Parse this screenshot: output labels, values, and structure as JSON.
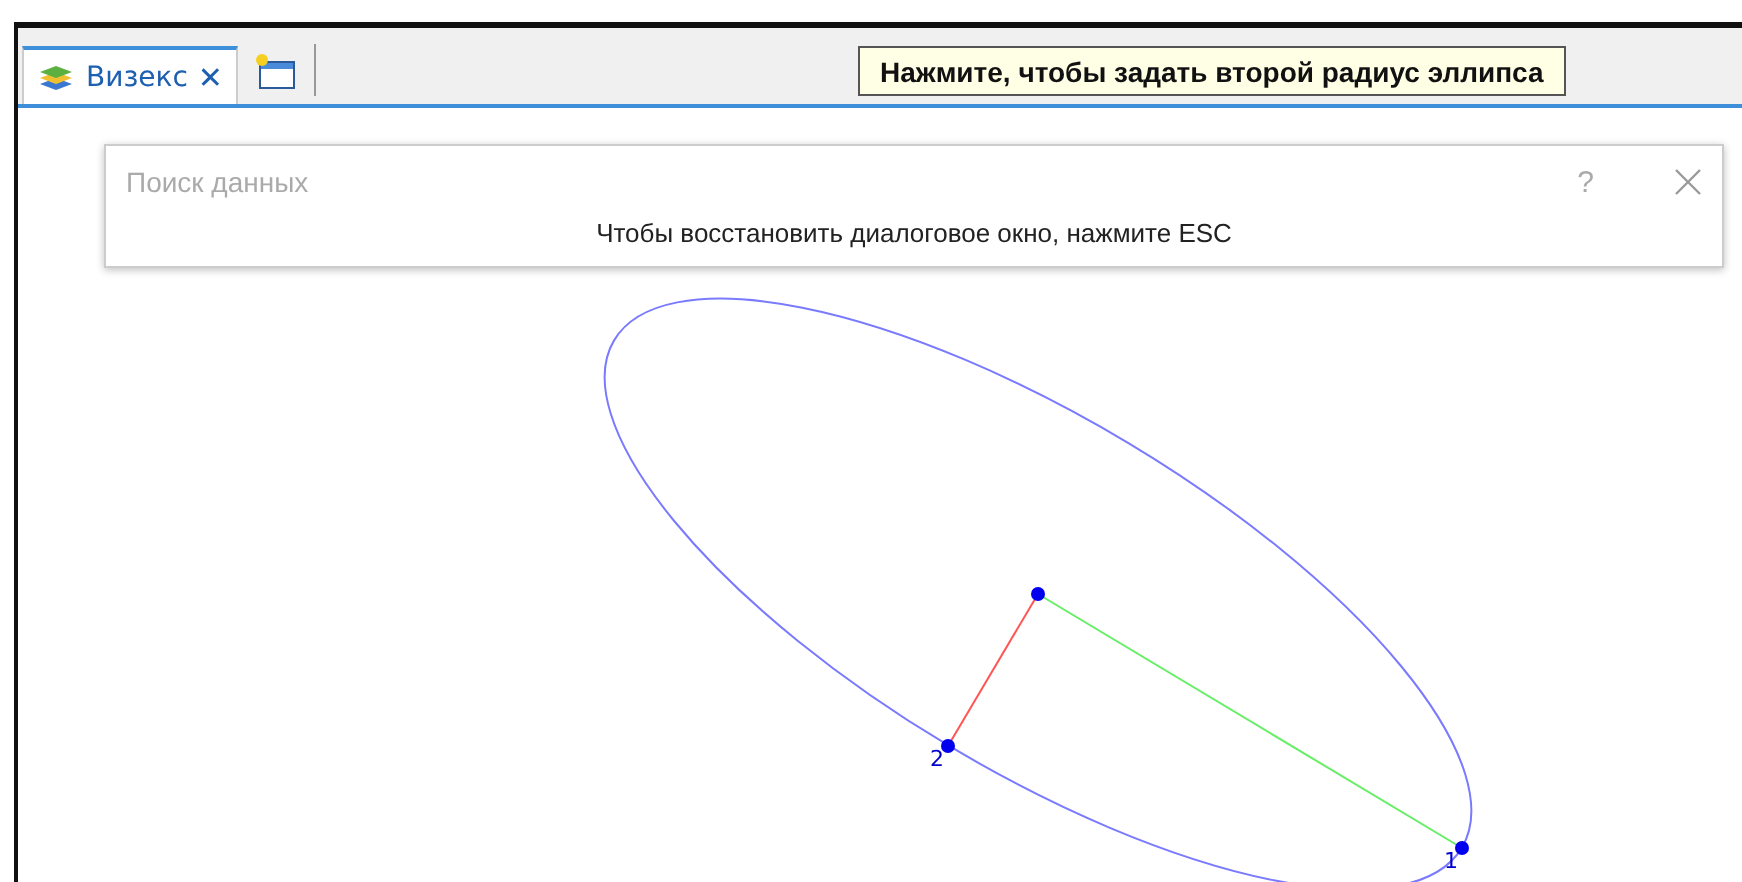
{
  "tabs": [
    {
      "label": "Визекс",
      "selected": true,
      "close": "✕"
    }
  ],
  "tooltip": "Нажмите, чтобы задать второй радиус эллипса",
  "dialog": {
    "title": "Поиск данных",
    "help": "?",
    "message": "Чтобы восстановить диалоговое окно, нажмите ESC"
  },
  "points": [
    {
      "label": "1"
    },
    {
      "label": "2"
    }
  ]
}
